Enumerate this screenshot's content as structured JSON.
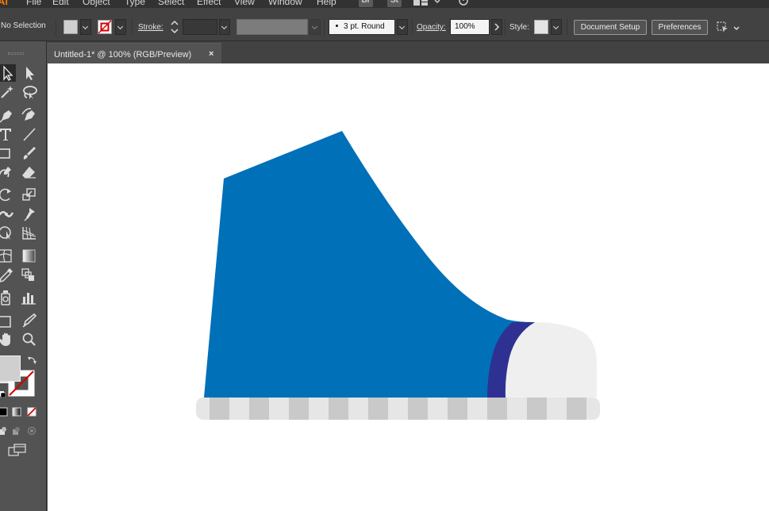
{
  "app": {
    "logo": "Ai"
  },
  "menubar": {
    "items": [
      "File",
      "Edit",
      "Object",
      "Type",
      "Select",
      "Effect",
      "View",
      "Window",
      "Help"
    ],
    "bridge_badge": "Br",
    "stock_badge": "St"
  },
  "control_bar": {
    "selection_status": "No Selection",
    "stroke_label": "Stroke:",
    "brush_profile": "3 pt. Round",
    "opacity_label": "Opacity:",
    "opacity_value": "100%",
    "style_label": "Style:",
    "document_setup_label": "Document Setup",
    "preferences_label": "Preferences"
  },
  "document_tab": {
    "title": "Untitled-1* @ 100% (RGB/Preview)",
    "close_glyph": "×"
  },
  "colors": {
    "shoe_body": "#0070b8",
    "shoe_band": "#2e3192",
    "toe_cap": "#efefef",
    "sole_light": "#e6e6e6",
    "sole_dark": "#c9c9c9"
  },
  "tools": [
    "selection-tool",
    "direct-selection-tool",
    "magic-wand-tool",
    "lasso-tool",
    "pen-tool",
    "curvature-tool",
    "type-tool",
    "line-segment-tool",
    "rectangle-tool",
    "paintbrush-tool",
    "shaper-tool",
    "eraser-tool",
    "rotate-tool",
    "scale-tool",
    "width-tool",
    "puppet-warp-tool",
    "shape-builder-tool",
    "perspective-grid-tool",
    "mesh-tool",
    "gradient-tool",
    "eyedropper-tool",
    "blend-tool",
    "symbol-sprayer-tool",
    "column-graph-tool",
    "artboard-tool",
    "slice-tool",
    "hand-tool",
    "zoom-tool"
  ]
}
